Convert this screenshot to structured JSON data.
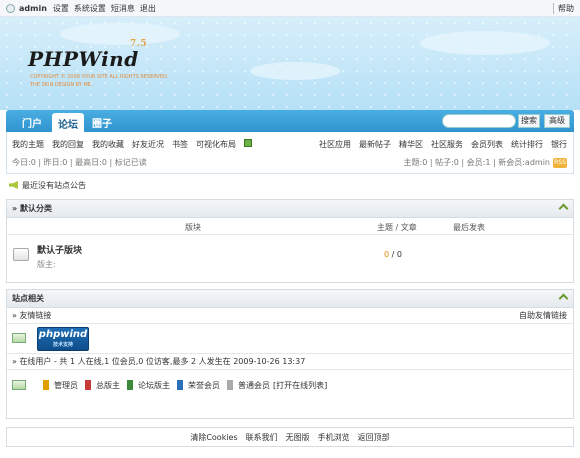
{
  "topbar": {
    "username": "admin",
    "links": [
      "设置",
      "系统设置",
      "短消息",
      "退出"
    ],
    "help": "帮助"
  },
  "header": {
    "logo_text": "PHPWind",
    "version": "7.5",
    "logo_subtitle_line1": "COPYRIGHT © 2009 YOUR SITE ALL RIGHTS RESERVED.",
    "logo_subtitle_line2": "THE SKIN DESIGN BY ME."
  },
  "nav": {
    "tabs": [
      "门户",
      "论坛",
      "圈子"
    ],
    "search_button": "搜索",
    "advanced_button": "高级"
  },
  "subnav": {
    "left_links": [
      "我的主题",
      "我的回复",
      "我的收藏",
      "好友近况",
      "书签",
      "可视化布局"
    ],
    "right_links": [
      "社区应用",
      "最新帖子",
      "精华区",
      "社区服务",
      "会员列表",
      "统计排行",
      "银行"
    ],
    "stats_left": "今日:0 | 昨日:0 | 最高日:0 | 标记已读",
    "stats_right": "主题:0 | 帖子:0 | 会员:1 | 新会员:admin",
    "rss": "RSS"
  },
  "announcement": {
    "text": "最近没有站点公告"
  },
  "category": {
    "title": "» 默认分类",
    "col_board": "版块",
    "col_topics": "主题 / 文章",
    "col_latest": "最后发表",
    "forum_name": "默认子版块",
    "forum_moderator": "版主:",
    "forum_topics": "0",
    "forum_posts": "/ 0"
  },
  "site": {
    "title": "站点相关",
    "links_label": "» 友情链接",
    "links_right": "自助友情链接",
    "partner_logo": "phpwind",
    "partner_logo_sub": "技术支持",
    "online_text": "» 在线用户  - 共 1 人在线,1 位会员,0 位访客,最多 2 人发生在 2009-10-26 13:37",
    "legend": [
      "管理员",
      "总版主",
      "论坛版主",
      "荣誉会员",
      "普通会员"
    ],
    "legend_colors": [
      "#e0a000",
      "#c83a3a",
      "#3a8a3a",
      "#2a6fb8",
      "#aaaaaa"
    ],
    "show_list": "[打开在线列表]"
  },
  "footer": {
    "links": [
      "清除Cookies",
      "联系我们",
      "无图版",
      "手机浏览",
      "返回顶部"
    ]
  }
}
